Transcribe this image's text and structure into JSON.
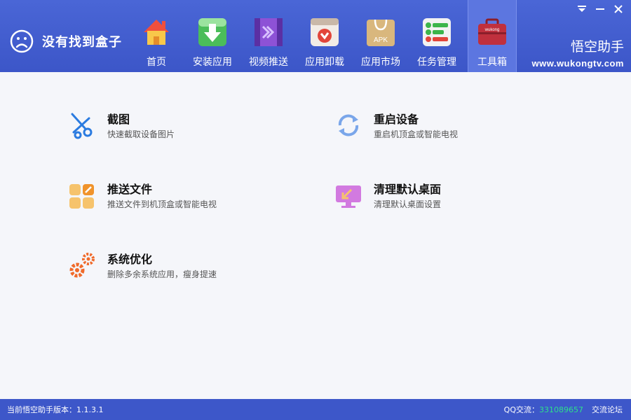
{
  "status": {
    "text": "没有找到盒子",
    "icon": "sad-face-icon"
  },
  "window_controls": [
    "menu-icon",
    "minimize-icon",
    "close-icon"
  ],
  "nav": {
    "items": [
      {
        "label": "首页",
        "icon": "home-icon"
      },
      {
        "label": "安装应用",
        "icon": "download-icon"
      },
      {
        "label": "视频推送",
        "icon": "video-push-icon"
      },
      {
        "label": "应用卸载",
        "icon": "uninstall-icon"
      },
      {
        "label": "应用市场",
        "icon": "apk-bag-icon"
      },
      {
        "label": "任务管理",
        "icon": "task-icon"
      },
      {
        "label": "工具箱",
        "icon": "toolbox-icon",
        "active": true
      }
    ],
    "toolbox_badge": "wukong",
    "apk_badge": "APK"
  },
  "brand": {
    "name": "悟空助手",
    "url": "www.wukongtv.com"
  },
  "tools": [
    {
      "title": "截图",
      "desc": "快速截取设备图片",
      "icon": "scissors-icon"
    },
    {
      "title": "重启设备",
      "desc": "重启机顶盒或智能电视",
      "icon": "refresh-icon"
    },
    {
      "title": "推送文件",
      "desc": "推送文件到机顶盒或智能电视",
      "icon": "push-file-icon"
    },
    {
      "title": "清理默认桌面",
      "desc": "清理默认桌面设置",
      "icon": "monitor-clean-icon"
    },
    {
      "title": "系统优化",
      "desc": "删除多余系统应用，瘦身提速",
      "icon": "gears-icon"
    }
  ],
  "footer": {
    "version_text": "当前悟空助手版本：1.1.3.1",
    "qq_label": "QQ交流：",
    "qq_number": "331089657",
    "forum_link": "交流论坛"
  },
  "colors": {
    "header": "#4a66d6",
    "footer": "#3d57c9",
    "accent_green": "#2de08a"
  }
}
